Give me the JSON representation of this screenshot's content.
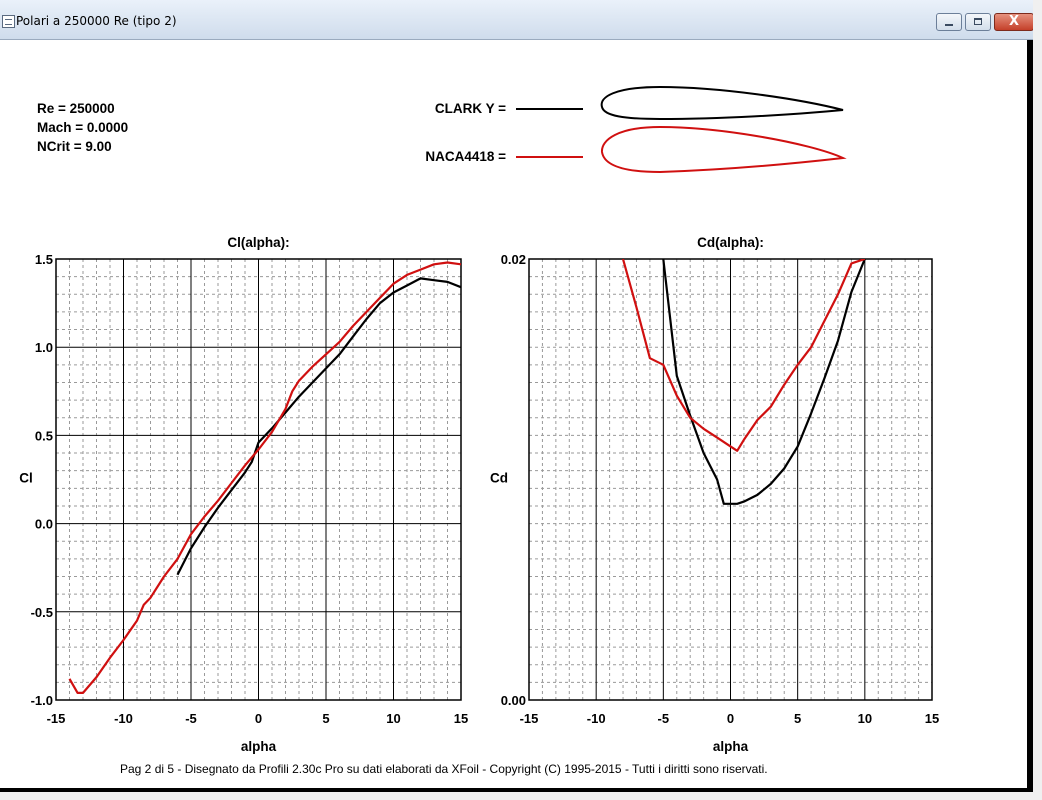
{
  "window": {
    "title": "Polari a 250000 Re (tipo 2)",
    "close_glyph": "X"
  },
  "params": [
    "Re = 250000",
    "Mach = 0.0000",
    "NCrit = 9.00"
  ],
  "legend": [
    {
      "label": "CLARK Y =",
      "color": "#000000"
    },
    {
      "label": "NACA4418 =",
      "color": "#d01010"
    }
  ],
  "footer": "Pag 2 di 5  -   Disegnato da Profili 2.30c Pro su dati elaborati da XFoil - Copyright (C) 1995-2015 - Tutti i diritti sono riservati.",
  "icons": {
    "window": "document-icon",
    "minimize": "minimize-icon",
    "maximize": "maximize-icon",
    "close": "close-icon"
  },
  "chart_data": [
    {
      "type": "line",
      "title": "Cl(alpha):",
      "xlabel": "alpha",
      "ylabel": "Cl",
      "xlim": [
        -15,
        15
      ],
      "ylim": [
        -1.0,
        1.5
      ],
      "xticks": [
        -15,
        -10,
        -5,
        0,
        5,
        10,
        15
      ],
      "yticks": [
        -1.0,
        -0.5,
        0.0,
        0.5,
        1.0,
        1.5
      ],
      "ytick_labels": [
        "-1.0",
        "-0.5",
        "0.0",
        "0.5",
        "1.0",
        "1.5"
      ],
      "grid": true,
      "series": [
        {
          "color": "#000000",
          "points": [
            [
              -6,
              -0.29
            ],
            [
              -5,
              -0.14
            ],
            [
              -4,
              -0.02
            ],
            [
              -3,
              0.09
            ],
            [
              -2,
              0.19
            ],
            [
              -1,
              0.29
            ],
            [
              -0.5,
              0.35
            ],
            [
              0,
              0.46
            ],
            [
              1,
              0.54
            ],
            [
              2,
              0.63
            ],
            [
              3,
              0.72
            ],
            [
              4,
              0.8
            ],
            [
              5,
              0.88
            ],
            [
              6,
              0.96
            ],
            [
              7,
              1.06
            ],
            [
              8,
              1.16
            ],
            [
              9,
              1.25
            ],
            [
              10,
              1.31
            ],
            [
              11,
              1.35
            ],
            [
              12,
              1.39
            ],
            [
              13,
              1.38
            ],
            [
              14,
              1.37
            ],
            [
              15,
              1.34
            ]
          ]
        },
        {
          "color": "#d01010",
          "points": [
            [
              -14,
              -0.88
            ],
            [
              -13.4,
              -0.96
            ],
            [
              -13,
              -0.96
            ],
            [
              -12,
              -0.87
            ],
            [
              -11,
              -0.76
            ],
            [
              -10,
              -0.66
            ],
            [
              -9,
              -0.55
            ],
            [
              -8.5,
              -0.46
            ],
            [
              -8,
              -0.42
            ],
            [
              -7,
              -0.3
            ],
            [
              -6,
              -0.2
            ],
            [
              -5,
              -0.06
            ],
            [
              -4,
              0.04
            ],
            [
              -3,
              0.13
            ],
            [
              -2,
              0.23
            ],
            [
              -1,
              0.33
            ],
            [
              0,
              0.42
            ],
            [
              1,
              0.52
            ],
            [
              2,
              0.65
            ],
            [
              2.5,
              0.75
            ],
            [
              3,
              0.81
            ],
            [
              4,
              0.89
            ],
            [
              5,
              0.96
            ],
            [
              6,
              1.03
            ],
            [
              7,
              1.12
            ],
            [
              8,
              1.2
            ],
            [
              9,
              1.28
            ],
            [
              10,
              1.36
            ],
            [
              11,
              1.41
            ],
            [
              12,
              1.44
            ],
            [
              13,
              1.47
            ],
            [
              14,
              1.48
            ],
            [
              15,
              1.47
            ]
          ]
        }
      ]
    },
    {
      "type": "line",
      "title": "Cd(alpha):",
      "xlabel": "alpha",
      "ylabel": "Cd",
      "xlim": [
        -15,
        15
      ],
      "ylim": [
        0.0,
        0.02
      ],
      "xticks": [
        -15,
        -10,
        -5,
        0,
        5,
        10,
        15
      ],
      "yticks": [
        0.0,
        0.02
      ],
      "ytick_labels": [
        "0.00",
        "0.02"
      ],
      "grid": true,
      "series": [
        {
          "color": "#000000",
          "points": [
            [
              -5,
              0.02
            ],
            [
              -4,
              0.0147
            ],
            [
              -3,
              0.0129
            ],
            [
              -2,
              0.0112
            ],
            [
              -1,
              0.01
            ],
            [
              -0.5,
              0.0089
            ],
            [
              0,
              0.0089
            ],
            [
              0.5,
              0.0089
            ],
            [
              1,
              0.009
            ],
            [
              2,
              0.0093
            ],
            [
              3,
              0.0098
            ],
            [
              4,
              0.0105
            ],
            [
              5,
              0.0115
            ],
            [
              6,
              0.013
            ],
            [
              7,
              0.0146
            ],
            [
              8,
              0.0163
            ],
            [
              9,
              0.0185
            ],
            [
              10,
              0.02
            ]
          ]
        },
        {
          "color": "#d01010",
          "points": [
            [
              -8,
              0.02
            ],
            [
              -7,
              0.0178
            ],
            [
              -6,
              0.0155
            ],
            [
              -5,
              0.0152
            ],
            [
              -4,
              0.0138
            ],
            [
              -3,
              0.0128
            ],
            [
              -2,
              0.0123
            ],
            [
              -1,
              0.0119
            ],
            [
              0,
              0.0115
            ],
            [
              0.5,
              0.0113
            ],
            [
              1,
              0.0118
            ],
            [
              2,
              0.0127
            ],
            [
              3,
              0.0133
            ],
            [
              4,
              0.0143
            ],
            [
              5,
              0.0152
            ],
            [
              6,
              0.016
            ],
            [
              7,
              0.0172
            ],
            [
              8,
              0.0184
            ],
            [
              9,
              0.0198
            ],
            [
              10,
              0.02
            ]
          ]
        }
      ]
    }
  ]
}
